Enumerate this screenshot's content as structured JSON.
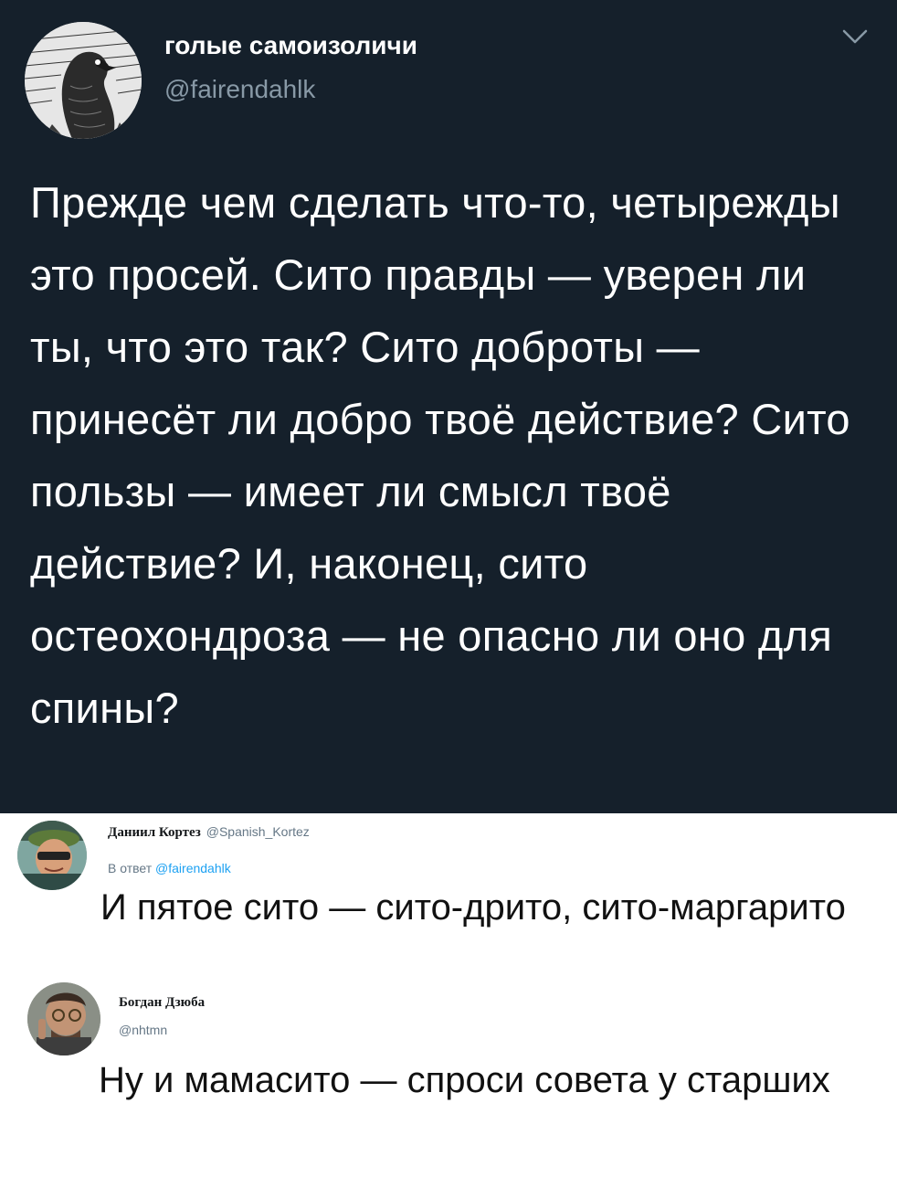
{
  "main_tweet": {
    "author_name": "голые самоизоличи",
    "author_handle": "@fairendahlk",
    "text": "Прежде чем сделать что-то, четырежды это просей. Сито правды — уверен ли ты, что это так? Сито доброты — принесёт ли добро твоё действие? Сито пользы — имеет ли смысл твоё действие? И, наконец, сито остеохондроза — не опасно ли оно для спины?",
    "menu_icon": "chevron-down-icon",
    "colors": {
      "background": "#15202b",
      "text": "#ffffff",
      "secondary": "#8899a6"
    }
  },
  "replies": [
    {
      "author_name": "Даниил Кортез",
      "author_handle": "@Spanish_Kortez",
      "reply_to_label": "В ответ",
      "reply_to_handle": "@fairendahlk",
      "text": "И пятое сито — сито-дрито, сито-маргарито"
    },
    {
      "author_name": "Богдан Дзюба",
      "author_handle": "@nhtmn",
      "text": "Ну и мамасито — спроси совета у старших"
    }
  ]
}
